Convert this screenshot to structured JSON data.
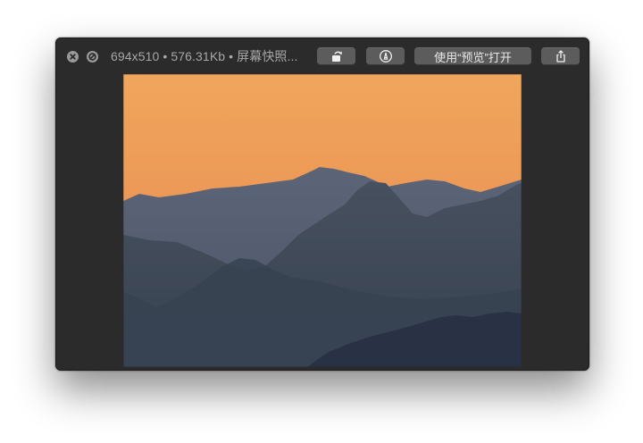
{
  "window": {
    "file_info": "694x510 • 576.31Kb • 屏幕快照...",
    "open_with_preview_label": "使用“预览”打开"
  },
  "icons": {
    "close": "close-icon",
    "fullscreen": "fullscreen-icon",
    "rotate": "rotate-icon",
    "markup": "markup-icon",
    "share": "share-icon"
  },
  "image": {
    "description_colors": {
      "sky_top": "#f0a35a",
      "sky_bottom": "#e98a53",
      "mountains_far": "#566073",
      "mountains_mid": "#3e495c",
      "mountains_near": "#2a3446"
    }
  }
}
